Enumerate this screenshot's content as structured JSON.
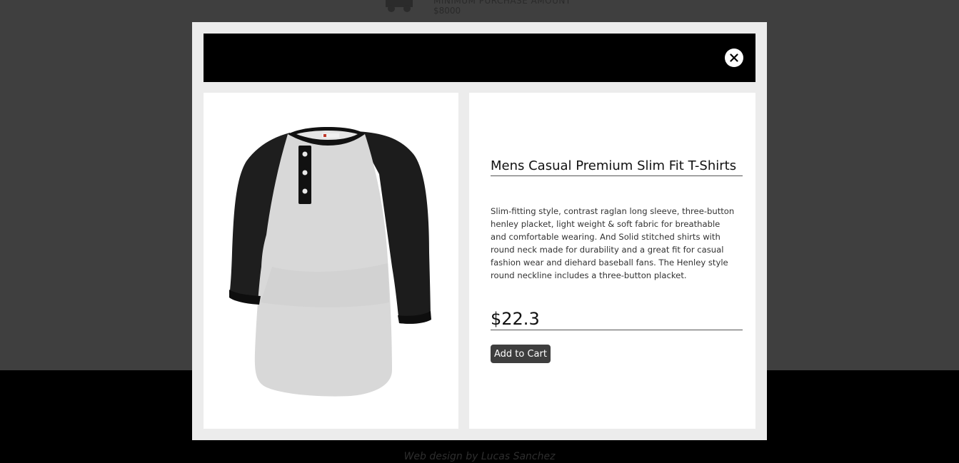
{
  "background": {
    "promo_label": "MINIMUM PURCHASE AMOUNT",
    "promo_value": "$8000",
    "footer_credit": "Web design by Lucas Sanchez"
  },
  "modal": {
    "close_icon": "close-icon",
    "product": {
      "title": "Mens Casual Premium Slim Fit T-Shirts",
      "description": "Slim-fitting style, contrast raglan long sleeve, three-button henley placket, light weight & soft fabric for breathable and comfortable wearing. And Solid stitched shirts with round neck made for durability and a great fit for casual fashion wear and diehard baseball fans. The Henley style round neckline includes a three-button placket.",
      "price": "$22.3",
      "add_to_cart_label": "Add to Cart"
    }
  },
  "colors": {
    "overlay": "#3f3f3f",
    "footer": "#000000",
    "modal_bg": "#ececec",
    "header_bar": "#000000",
    "button_bg": "#3e3e3e"
  }
}
